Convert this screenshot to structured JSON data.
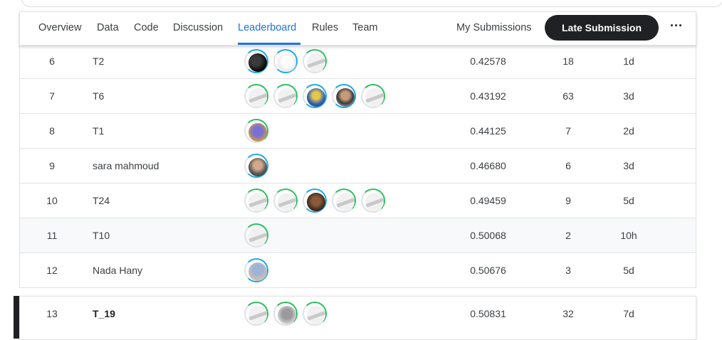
{
  "nav": {
    "tabs": [
      "Overview",
      "Data",
      "Code",
      "Discussion",
      "Leaderboard",
      "Rules",
      "Team"
    ],
    "active_tab": "Leaderboard",
    "my_submissions": "My Submissions",
    "late_submission": "Late Submission",
    "more": "···"
  },
  "rows": [
    {
      "rank": "6",
      "team": "T2",
      "avatars": [
        "dark",
        "owl",
        "goose"
      ],
      "score": "0.42578",
      "entries": "18",
      "last": "1d"
    },
    {
      "rank": "7",
      "team": "T6",
      "avatars": [
        "goose",
        "goose",
        "blue",
        "man",
        "goose"
      ],
      "score": "0.43192",
      "entries": "63",
      "last": "3d"
    },
    {
      "rank": "8",
      "team": "T1",
      "avatars": [
        "purple"
      ],
      "score": "0.44125",
      "entries": "7",
      "last": "2d"
    },
    {
      "rank": "9",
      "team": "sara mahmoud",
      "avatars": [
        "portrait"
      ],
      "score": "0.46680",
      "entries": "6",
      "last": "3d"
    },
    {
      "rank": "10",
      "team": "T24",
      "avatars": [
        "goose",
        "goose",
        "brown",
        "goose",
        "goose"
      ],
      "score": "0.49459",
      "entries": "9",
      "last": "5d"
    },
    {
      "rank": "11",
      "team": "T10",
      "avatars": [
        "goose"
      ],
      "score": "0.50068",
      "entries": "2",
      "last": "10h"
    },
    {
      "rank": "12",
      "team": "Nada Hany",
      "avatars": [
        "lightblue"
      ],
      "score": "0.50676",
      "entries": "3",
      "last": "5d"
    }
  ],
  "my_row": {
    "rank": "13",
    "team": "T_19",
    "avatars": [
      "goose",
      "gray",
      "goose"
    ],
    "score": "0.50831",
    "entries": "32",
    "last": "7d"
  }
}
